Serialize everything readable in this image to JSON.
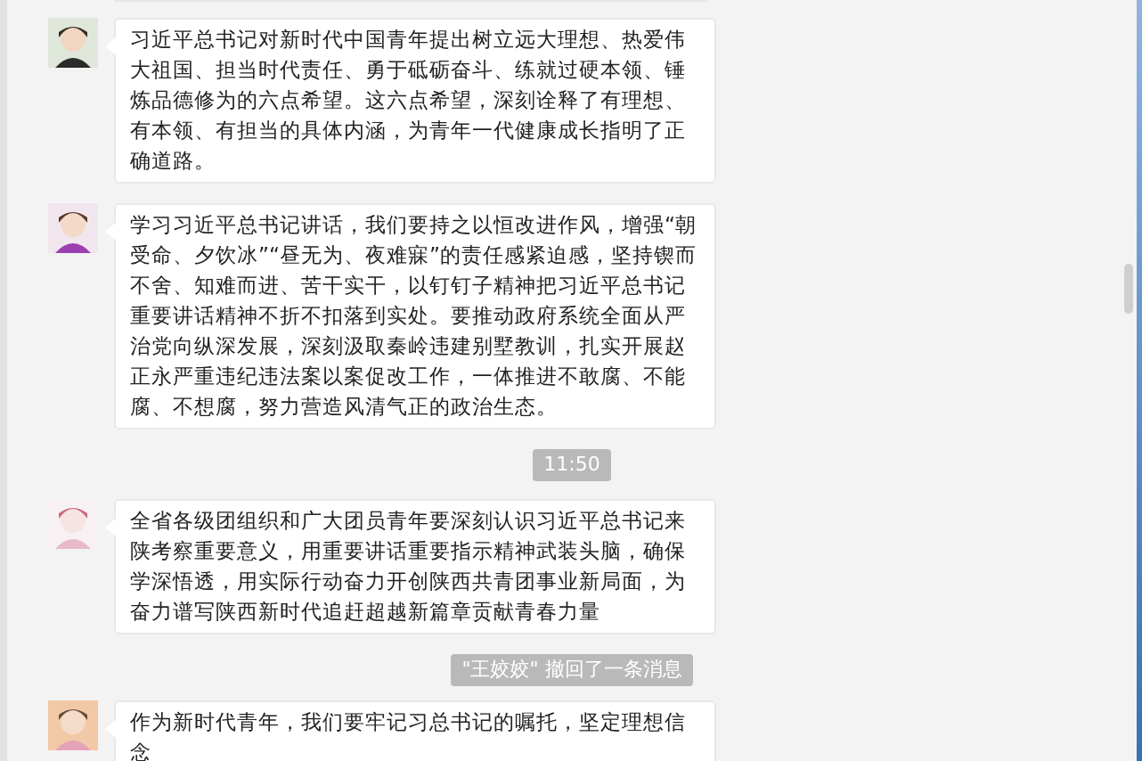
{
  "messages": [
    {
      "kind": "message",
      "text": "习近平总书记对新时代中国青年提出树立远大理想、热爱伟大祖国、担当时代责任、勇于砥砺奋斗、练就过硬本领、锤炼品德修为的六点希望。这六点希望，深刻诠释了有理想、有本领、有担当的具体内涵，为青年一代健康成长指明了正确道路。"
    },
    {
      "kind": "message",
      "text": "学习习近平总书记讲话，我们要持之以恒改进作风，增强“朝受命、夕饮冰”“昼无为、夜难寐”的责任感紧迫感，坚持锲而不舍、知难而进、苦干实干，以钉钉子精神把习近平总书记重要讲话精神不折不扣落到实处。要推动政府系统全面从严治党向纵深发展，深刻汲取秦岭违建别墅教训，扎实开展赵正永严重违纪违法案以案促改工作，一体推进不敢腐、不能腐、不想腐，努力营造风清气正的政治生态。"
    },
    {
      "kind": "time",
      "text": "11:50"
    },
    {
      "kind": "message",
      "text": "全省各级团组织和广大团员青年要深刻认识习近平总书记来陕考察重要意义，用重要讲话重要指示精神武装头脑，确保学深悟透，用实际行动奋力开创陕西共青团事业新局面，为奋力谱写陕西新时代追赶超越新篇章贡献青春力量"
    },
    {
      "kind": "recall",
      "text": "\"王姣姣\" 撤回了一条消息"
    },
    {
      "kind": "message",
      "text": "作为新时代青年，我们要牢记习总书记的嘱托，坚定理想信念"
    }
  ]
}
